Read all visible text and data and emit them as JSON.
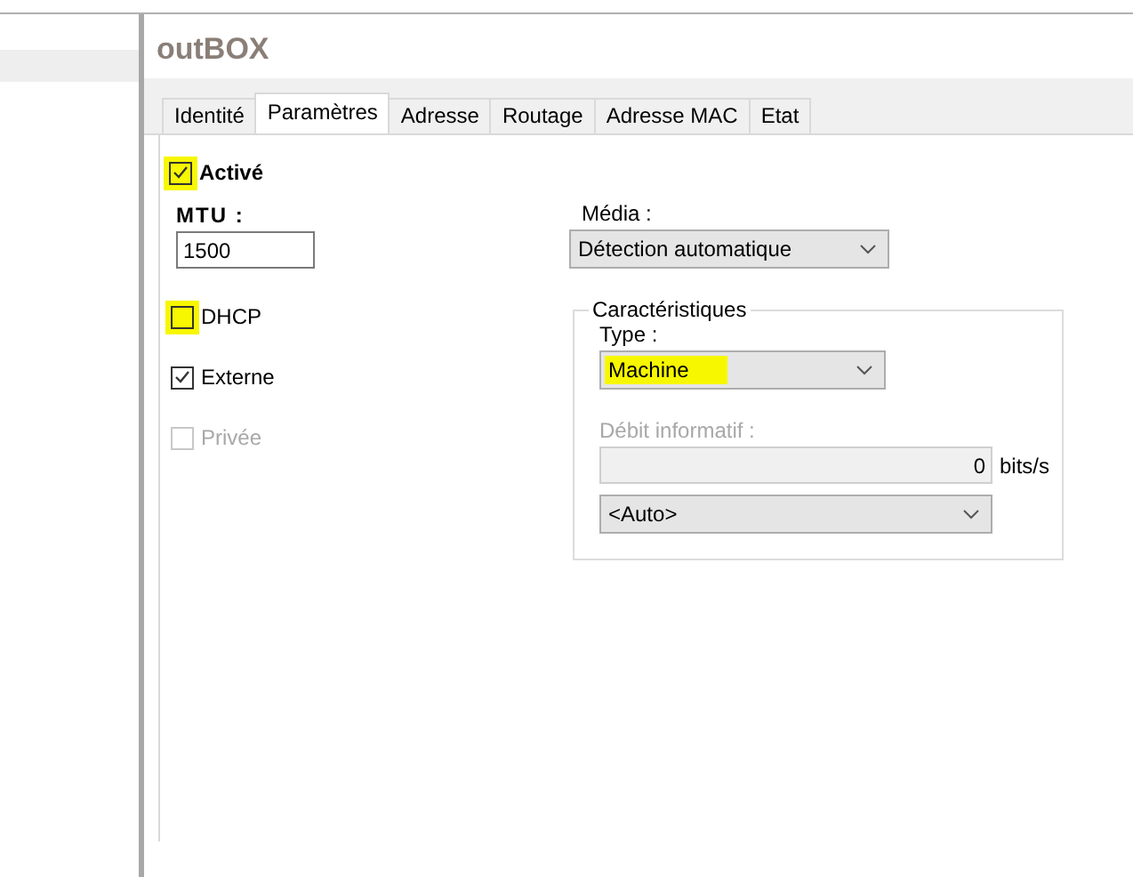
{
  "title": "outBOX",
  "tabs": [
    {
      "label": "Identité",
      "selected": false
    },
    {
      "label": "Paramètres",
      "selected": true
    },
    {
      "label": "Adresse",
      "selected": false
    },
    {
      "label": "Routage",
      "selected": false
    },
    {
      "label": "Adresse MAC",
      "selected": false
    },
    {
      "label": "Etat",
      "selected": false
    }
  ],
  "enabled": {
    "label": "Activé",
    "checked": true,
    "highlighted": true
  },
  "mtu": {
    "label": "MTU :",
    "value": "1500"
  },
  "options": [
    {
      "label": "DHCP",
      "checked": false,
      "disabled": false,
      "highlighted": true
    },
    {
      "label": "Externe",
      "checked": true,
      "disabled": false,
      "highlighted": false
    },
    {
      "label": "Privée",
      "checked": false,
      "disabled": true,
      "highlighted": false
    }
  ],
  "media": {
    "label": "Média :",
    "value": "Détection automatique"
  },
  "characteristics": {
    "title": "Caractéristiques",
    "type": {
      "label": "Type :",
      "value": "Machine",
      "highlighted": true
    },
    "rate": {
      "label": "Débit informatif :",
      "value": "0",
      "unit": "bits/s",
      "disabled": true
    },
    "rate_mode": {
      "value": "<Auto>"
    }
  }
}
